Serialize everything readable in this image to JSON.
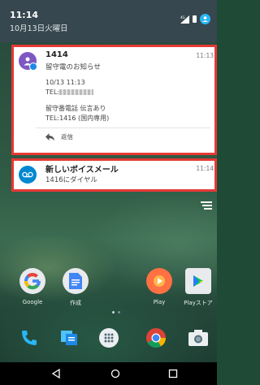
{
  "status_bar": {
    "time": "11:14",
    "date": "10月13日火曜日"
  },
  "notification_1": {
    "title": "1414",
    "time": "11:13",
    "subtitle": "留守電のお知らせ",
    "line1": "10/13 11:13",
    "line2_prefix": "TEL:",
    "line3": "留守番電話 伝言あり",
    "line4": "TEL:1416 (国内専用)",
    "reply_label": "返信"
  },
  "notification_2": {
    "title": "新しいボイスメール",
    "subtitle": "1416にダイヤル",
    "time": "11:14"
  },
  "home": {
    "apps": [
      {
        "label": "Google",
        "icon": "google-folder-icon"
      },
      {
        "label": "作成",
        "icon": "docs-icon"
      },
      {
        "label": "Play",
        "icon": "play-music-icon"
      },
      {
        "label": "Playストア",
        "icon": "play-store-icon"
      }
    ],
    "dock": [
      "phone-icon",
      "messages-icon",
      "app-drawer-icon",
      "chrome-icon",
      "camera-icon"
    ]
  },
  "colors": {
    "highlight": "#e53935",
    "header": "#37474f",
    "avatar_purple": "#7e57c2",
    "voicemail_blue": "#0288d1"
  }
}
